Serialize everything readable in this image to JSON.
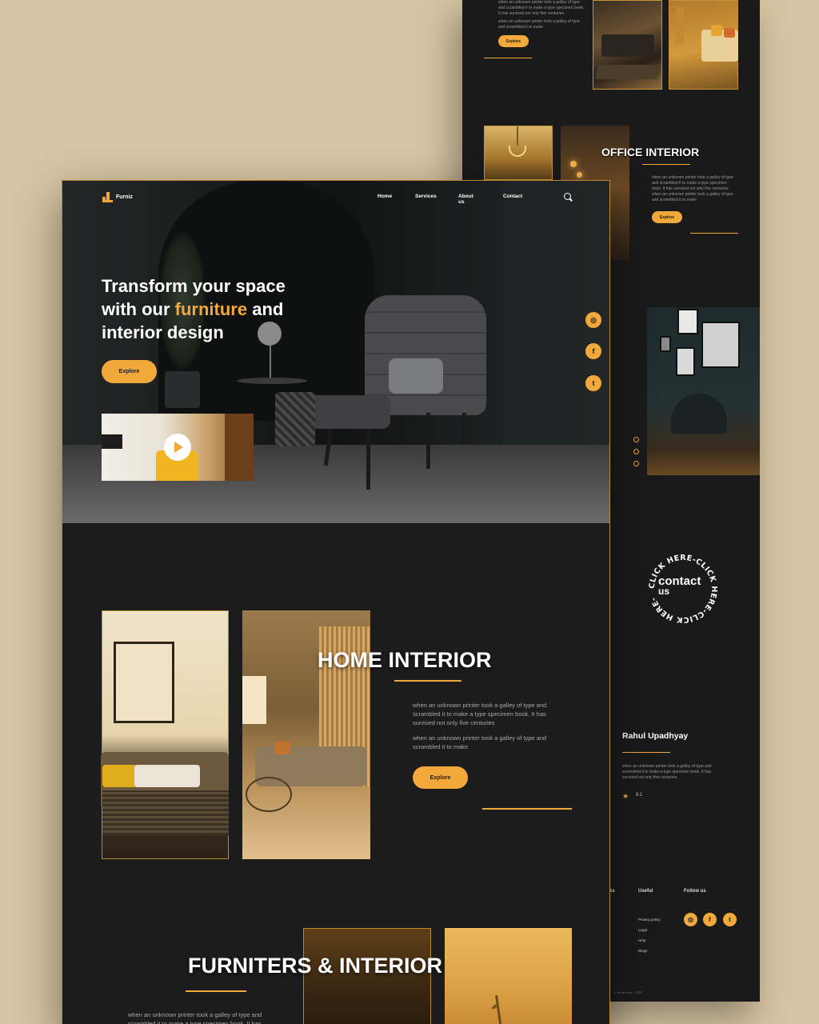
{
  "back": {
    "top_text_1": "when an unknown printer took a galley of type and scrambled it to make a type specimen book. It has survived not only five centuries",
    "top_text_2": "when an unknown printer took a galley of type and scrambled it to make",
    "top_explore": "Explore",
    "office_title": "OFFICE INTERIOR",
    "office_text_1": "when an unknown printer took a galley of type and scrambled it to make a type specimen book. It has survived not only five centuries",
    "office_text_2": "when an unknown printer took a galley of type and scrambled it to make",
    "office_explore": "Explore",
    "contact_ring": "CLICK HERE-CLICK HERE-CLICK HERE-",
    "contact_line1": "contact",
    "contact_line2": "us",
    "testimonial_name": "Rahul Upadhyay",
    "testimonial_text": "when an unknown printer took a galley of type and scrambled it to make a type specimen book. It has survived not only five centuries",
    "rating": "9.1",
    "footer_col_useful": "Useful",
    "footer_col_follow": "Follow us",
    "footer_col_partial": "ks",
    "useful_links": [
      "Privacy policy",
      "Legal",
      "Help",
      "Blogs"
    ],
    "copyright": "© furniz.com - 2021"
  },
  "front": {
    "brand": "Furniz",
    "nav": [
      "Home",
      "Services",
      "About us",
      "Contact"
    ],
    "hero_line1": "Transform your space",
    "hero_line2_a": "with our ",
    "hero_line2_hl": "furniture",
    "hero_line2_b": " and",
    "hero_line3": "interior design",
    "hero_explore": "Explore",
    "home_title": "HOME INTERIOR",
    "home_text_1": "when an unknown printer took a galley of type and scrambled it to make a type specimen book. It has survived not only five centuries",
    "home_text_2": "when an unknown printer took a galley of type and scrambled it to make",
    "home_explore": "Explore",
    "furn_title": "FURNITERS & INTERIOR",
    "furn_text": "when an unknown printer took a galley of type and scrambled it to make a type specimen book. It has"
  },
  "colors": {
    "accent": "#f2a93b",
    "page_bg": "#d7c4a2",
    "panel": "#1c1c1d"
  },
  "icons": [
    "search-icon",
    "instagram-icon",
    "facebook-icon",
    "twitter-icon",
    "play-icon",
    "star-icon",
    "logo-icon"
  ]
}
